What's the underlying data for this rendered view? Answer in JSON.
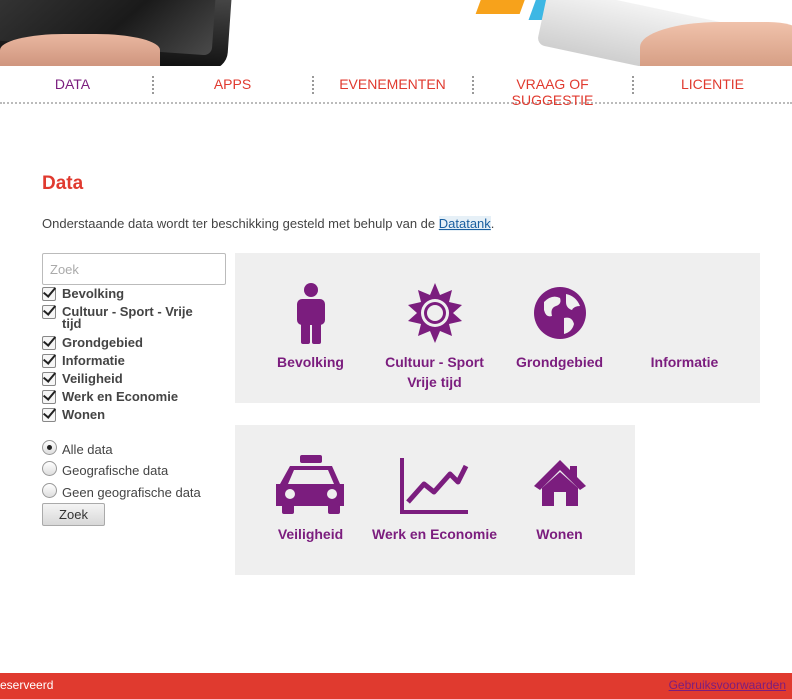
{
  "nav": {
    "items": [
      {
        "label": "DATA",
        "active": true
      },
      {
        "label": "APPS",
        "active": false
      },
      {
        "label": "EVENEMENTEN",
        "active": false
      },
      {
        "label": "VRAAG OF SUGGESTIE",
        "active": false
      },
      {
        "label": "LICENTIE",
        "active": false
      }
    ]
  },
  "page": {
    "title": "Data",
    "intro_text": "Onderstaande data wordt ter beschikking gesteld met behulp van de ",
    "intro_link": "Datatank",
    "intro_end": "."
  },
  "filters": {
    "search_placeholder": "Zoek",
    "categories": [
      {
        "label": "Bevolking",
        "checked": true
      },
      {
        "label": "Cultuur - Sport - Vrije tijd",
        "checked": true
      },
      {
        "label": "Grondgebied",
        "checked": true
      },
      {
        "label": "Informatie",
        "checked": true
      },
      {
        "label": "Veiligheid",
        "checked": true
      },
      {
        "label": "Werk en Economie",
        "checked": true
      },
      {
        "label": "Wonen",
        "checked": true
      }
    ],
    "data_types": [
      {
        "label": "Alle data",
        "selected": true
      },
      {
        "label": "Geografische data",
        "selected": false
      },
      {
        "label": "Geen geografische data",
        "selected": false
      }
    ],
    "submit_label": "Zoek"
  },
  "tiles": [
    {
      "label": "Bevolking",
      "icon": "person-icon"
    },
    {
      "label": "Cultuur - Sport Vrije tijd",
      "icon": "sun-icon"
    },
    {
      "label": "Grondgebied",
      "icon": "globe-icon"
    },
    {
      "label": "Informatie",
      "icon": ""
    },
    {
      "label": "Veiligheid",
      "icon": "taxi-icon"
    },
    {
      "label": "Werk en Economie",
      "icon": "chart-icon"
    },
    {
      "label": "Wonen",
      "icon": "house-icon"
    }
  ],
  "footer": {
    "left_text": "eserveerd",
    "right_link": "Gebruiksvoorwaarden"
  },
  "colors": {
    "accent_red": "#e03a2f",
    "purple": "#7b1d7e",
    "panel_bg": "#efefef"
  }
}
